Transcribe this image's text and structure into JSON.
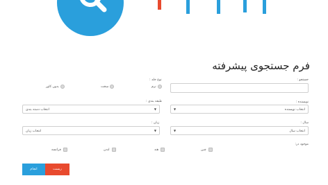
{
  "form": {
    "title": "فرم جستجوی پیشرفته",
    "keyword_label": "جستجو :",
    "author_label": "نویسنده :",
    "author_select": "انتخاب نویسنده",
    "year_label": "سال :",
    "year_select": "انتخاب سال",
    "found_in_label": "موجود در:",
    "found_in": [
      "چین",
      "هند",
      "لندن",
      "فرانسه"
    ],
    "type_label": "نوع جلد :",
    "type_options": [
      "نرم",
      "سخت",
      "بدون کاور"
    ],
    "category_label": "طبقه بندی :",
    "category_select": "انتخاب دسته بندی",
    "language_label": "زبان :",
    "language_select": "انتخاب زبان"
  },
  "buttons": {
    "reset": "ریست",
    "submit": "انجام"
  },
  "colors": {
    "brand_blue": "#2a9fdc",
    "brand_red": "#e84a2e",
    "submit_bg": "#2a9fdc",
    "reset_bg": "#e84a2e"
  },
  "icons": {
    "logo": "search-icon",
    "select_caret": "caret-down-icon"
  }
}
